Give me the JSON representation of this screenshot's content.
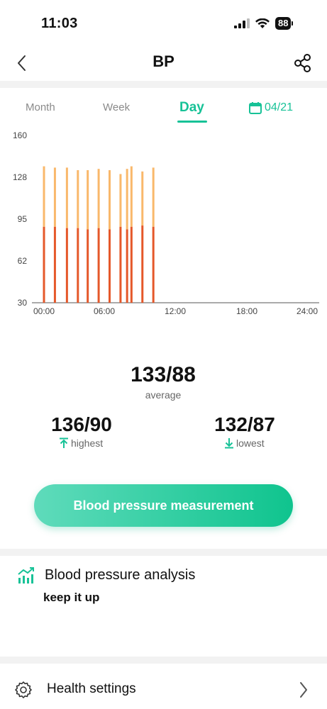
{
  "status_bar": {
    "time": "11:03",
    "battery": "88"
  },
  "header": {
    "title": "BP",
    "back_icon": "chevron-left-icon",
    "share_icon": "share-icon"
  },
  "tabs": [
    {
      "label": "Month",
      "active": false
    },
    {
      "label": "Week",
      "active": false
    },
    {
      "label": "Day",
      "active": true
    }
  ],
  "date_selector": {
    "label": "04/21",
    "icon": "calendar-icon"
  },
  "chart_data": {
    "type": "bar",
    "title": "",
    "xlabel": "",
    "ylabel": "",
    "y_ticks": [
      "160",
      "128",
      "95",
      "62",
      "30"
    ],
    "x_ticks": [
      "00:00",
      "06:00",
      "12:00",
      "18:00",
      "24:00"
    ],
    "ylim": [
      30,
      160
    ],
    "xlim_hours": [
      0,
      24
    ],
    "grid": false,
    "series_colors": {
      "systolic": "#f9b86b",
      "diastolic": "#e5582a"
    },
    "series": [
      {
        "name": "",
        "values_systolic": [
          136,
          135,
          135,
          133,
          133,
          134,
          133,
          130,
          134,
          136,
          132,
          135
        ]
      },
      {
        "name": "",
        "values_diastolic": [
          89,
          89,
          88,
          88,
          87,
          88,
          87,
          89,
          87,
          89,
          90,
          89
        ]
      }
    ],
    "times_hours": [
      0.0,
      1.0,
      2.1,
      3.1,
      4.0,
      5.0,
      6.0,
      7.0,
      7.6,
      8.0,
      9.0,
      10.0
    ]
  },
  "stats": {
    "average_value": "133/88",
    "average_label": "average",
    "highest_value": "136/90",
    "highest_label": "highest",
    "lowest_value": "132/87",
    "lowest_label": "lowest"
  },
  "measure_button": {
    "label": "Blood pressure measurement"
  },
  "analysis": {
    "title": "Blood pressure analysis",
    "subtitle": "keep it up",
    "icon": "trend-chart-icon"
  },
  "settings": {
    "label": "Health settings",
    "icon": "gear-icon"
  },
  "colors": {
    "accent": "#17c297"
  }
}
